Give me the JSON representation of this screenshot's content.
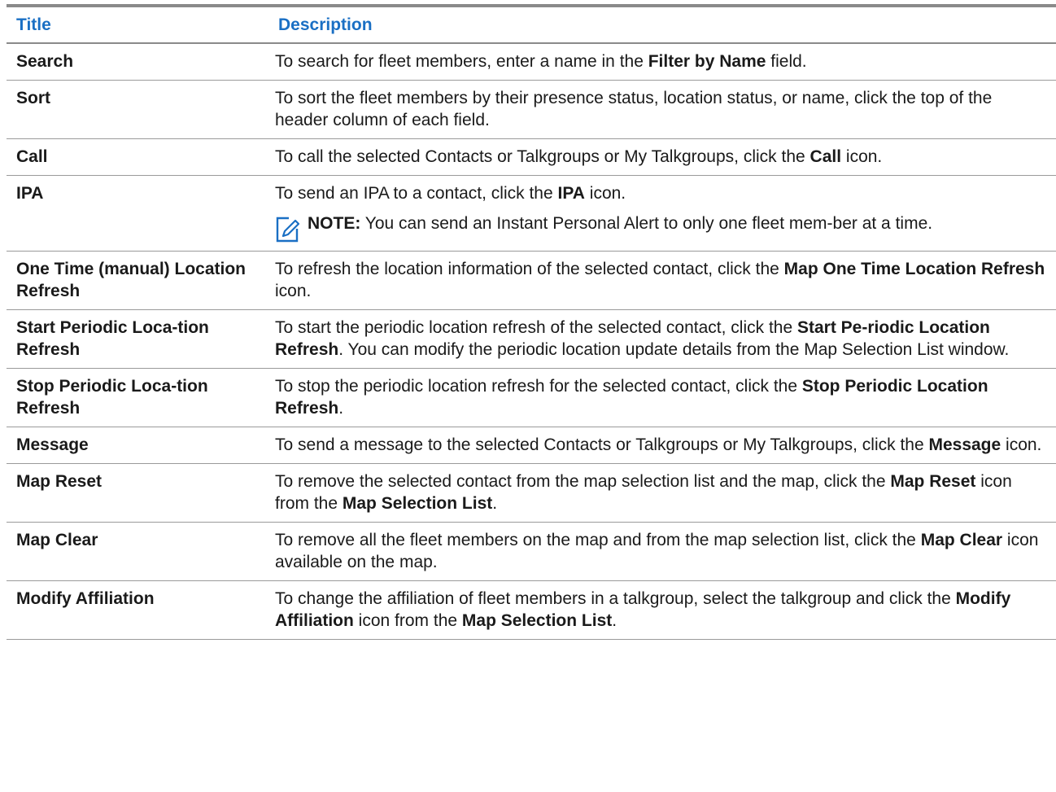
{
  "table": {
    "headers": {
      "title": "Title",
      "description": "Description"
    },
    "rows": [
      {
        "title": "Search",
        "desc": [
          {
            "t": "To search for fleet members, enter a name in the "
          },
          {
            "t": "Filter by Name",
            "b": true
          },
          {
            "t": " field."
          }
        ]
      },
      {
        "title": "Sort",
        "desc": [
          {
            "t": "To sort the fleet members by their presence status, location status, or name, click the top of the header column of each field."
          }
        ]
      },
      {
        "title": "Call",
        "desc": [
          {
            "t": "To call the selected Contacts or Talkgroups or My Talkgroups, click the "
          },
          {
            "t": "Call",
            "b": true
          },
          {
            "t": " icon."
          }
        ]
      },
      {
        "title": "IPA",
        "desc": [
          {
            "t": "To send an IPA to a contact, click the "
          },
          {
            "t": "IPA",
            "b": true
          },
          {
            "t": " icon."
          }
        ],
        "note": {
          "label": "NOTE:",
          "text": " You can send an Instant Personal Alert to only one fleet mem-ber at a time.",
          "icon": "note-pencil-icon"
        }
      },
      {
        "title": "One Time (manual) Location Refresh",
        "desc": [
          {
            "t": "To refresh the location information of the selected contact, click the "
          },
          {
            "t": "Map One Time Location Refresh",
            "b": true
          },
          {
            "t": " icon."
          }
        ]
      },
      {
        "title": "Start Periodic Loca-tion Refresh",
        "desc": [
          {
            "t": "To start the periodic location refresh of the selected contact, click the "
          },
          {
            "t": "Start Pe-riodic Location Refresh",
            "b": true
          },
          {
            "t": ". You can modify the periodic location update details from the Map Selection List window."
          }
        ]
      },
      {
        "title": "Stop Periodic Loca-tion Refresh",
        "desc": [
          {
            "t": "To stop the periodic location refresh for the selected contact, click the "
          },
          {
            "t": "Stop Periodic Location Refresh",
            "b": true
          },
          {
            "t": "."
          }
        ]
      },
      {
        "title": "Message",
        "desc": [
          {
            "t": "To send a message to the selected Contacts or Talkgroups or My Talkgroups, click the "
          },
          {
            "t": "Message",
            "b": true
          },
          {
            "t": " icon."
          }
        ]
      },
      {
        "title": "Map Reset",
        "desc": [
          {
            "t": "To remove the selected contact from the map selection list and the map, click the "
          },
          {
            "t": "Map Reset",
            "b": true
          },
          {
            "t": " icon from the "
          },
          {
            "t": "Map Selection List",
            "b": true
          },
          {
            "t": "."
          }
        ]
      },
      {
        "title": "Map Clear",
        "desc": [
          {
            "t": "To remove all the fleet members on the map and from the map selection list, click the "
          },
          {
            "t": "Map Clear",
            "b": true
          },
          {
            "t": " icon available on the map."
          }
        ]
      },
      {
        "title": "Modify Affiliation",
        "desc": [
          {
            "t": "To change the affiliation of fleet members in a talkgroup, select the talkgroup and click the "
          },
          {
            "t": "Modify Affiliation",
            "b": true
          },
          {
            "t": " icon from the "
          },
          {
            "t": "Map Selection List",
            "b": true
          },
          {
            "t": "."
          }
        ]
      }
    ]
  }
}
